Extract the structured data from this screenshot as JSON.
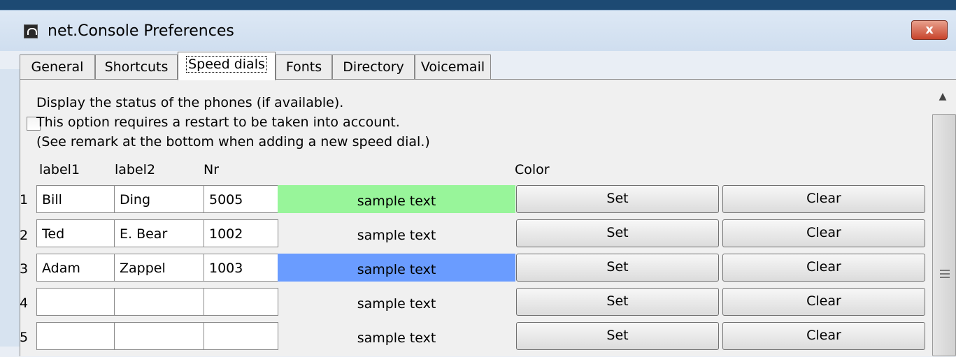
{
  "window": {
    "title": "net.Console Preferences",
    "close_label": "x"
  },
  "tabs": [
    {
      "label": "General"
    },
    {
      "label": "Shortcuts"
    },
    {
      "label": "Speed dials",
      "active": true
    },
    {
      "label": "Fonts"
    },
    {
      "label": "Directory"
    },
    {
      "label": "Voicemail"
    }
  ],
  "options": {
    "line1": "Display the status of the phones (if available).",
    "line2": "This option requires a restart to be taken into account.",
    "line3": "(See remark at the bottom when adding a new speed dial.)",
    "status_checkbox_checked": false
  },
  "headers": {
    "label1": "label1",
    "label2": "label2",
    "nr": "Nr",
    "color": "Color"
  },
  "rows": [
    {
      "num": "1",
      "label1": "Bill",
      "label2": "Ding",
      "nr": "5005",
      "sample": "sample text",
      "color": "#98f59a",
      "set": "Set",
      "clear": "Clear"
    },
    {
      "num": "2",
      "label1": "Ted",
      "label2": "E. Bear",
      "nr": "1002",
      "sample": "sample text",
      "color": "",
      "set": "Set",
      "clear": "Clear"
    },
    {
      "num": "3",
      "label1": "Adam",
      "label2": "Zappel",
      "nr": "1003",
      "sample": "sample text",
      "color": "#6a9cff",
      "set": "Set",
      "clear": "Clear"
    },
    {
      "num": "4",
      "label1": "",
      "label2": "",
      "nr": "",
      "sample": "sample text",
      "color": "",
      "set": "Set",
      "clear": "Clear"
    },
    {
      "num": "5",
      "label1": "",
      "label2": "",
      "nr": "",
      "sample": "sample text",
      "color": "",
      "set": "Set",
      "clear": "Clear"
    }
  ]
}
